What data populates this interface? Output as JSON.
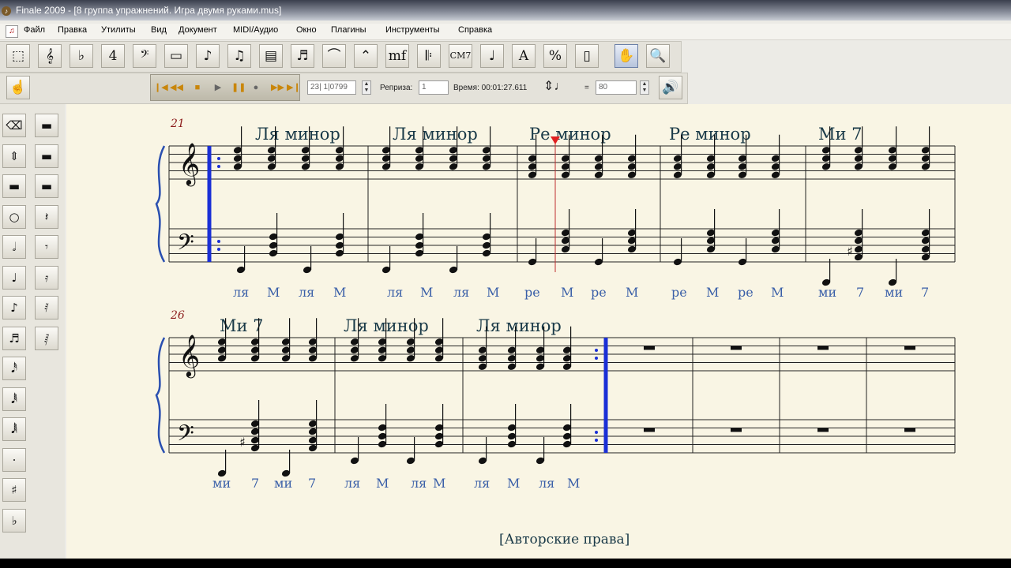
{
  "window": {
    "title": "Finale 2009 - [8 группа упражнений. Игра двумя руками.mus]"
  },
  "menu": [
    "Файл",
    "Правка",
    "Утилиты",
    "Вид",
    "Документ",
    "MIDI/Аудио",
    "Окно",
    "Плагины",
    "Инструменты",
    "Справка"
  ],
  "toolbar": {
    "tools": [
      {
        "icon": "selection-tool-icon",
        "glyph": "⬚"
      },
      {
        "icon": "staff-tool-icon",
        "glyph": "𝄞"
      },
      {
        "icon": "key-signature-tool-icon",
        "glyph": "♭"
      },
      {
        "icon": "time-signature-tool-icon",
        "glyph": "4"
      },
      {
        "icon": "clef-tool-icon",
        "glyph": "𝄢"
      },
      {
        "icon": "measure-tool-icon",
        "glyph": "▭"
      },
      {
        "icon": "simple-entry-tool-icon",
        "glyph": "♪"
      },
      {
        "icon": "speedy-entry-tool-icon",
        "glyph": "♫"
      },
      {
        "icon": "hyperscribe-tool-icon",
        "glyph": "▤"
      },
      {
        "icon": "tuplet-tool-icon",
        "glyph": "♬"
      },
      {
        "icon": "smart-shape-tool-icon",
        "glyph": "⌒"
      },
      {
        "icon": "articulation-tool-icon",
        "glyph": "⌃"
      },
      {
        "icon": "expression-tool-icon",
        "glyph": "mf"
      },
      {
        "icon": "repeat-tool-icon",
        "glyph": "𝄆"
      },
      {
        "icon": "chord-tool-icon",
        "glyph": "CM7"
      },
      {
        "icon": "lyrics-tool-icon",
        "glyph": "♩"
      },
      {
        "icon": "text-tool-icon",
        "glyph": "A"
      },
      {
        "icon": "resize-tool-icon",
        "glyph": "%"
      },
      {
        "icon": "page-layout-tool-icon",
        "glyph": "▯"
      },
      {
        "icon": "hand-grabber-tool-icon",
        "glyph": "✋"
      },
      {
        "icon": "zoom-tool-icon",
        "glyph": "🔍"
      }
    ]
  },
  "playback": {
    "counter": "23| 1|0799",
    "repeat_label": "Реприза:",
    "repeat_value": "1",
    "time_label": "Время: 00:01:27.611",
    "equals": "=",
    "tempo_value": "80"
  },
  "palette": {
    "col1": [
      "eraser-icon",
      "half-step-icon",
      "multirest-icon",
      "whole-note-icon",
      "half-note-icon",
      "quarter-note-icon",
      "eighth-note-icon",
      "sixteenth-note-icon",
      "thirty-second-note-icon",
      "sixty-fourth-note-icon",
      "one-twenty-eighth-note-icon",
      "dot-icon",
      "sharp-icon",
      "flat-icon"
    ],
    "col2": [
      "whole-rest-icon",
      "half-rest-icon",
      "half-rest-alt-icon",
      "quarter-rest-icon",
      "eighth-rest-icon",
      "sixteenth-rest-icon",
      "thirty-second-rest-icon",
      "sixty-fourth-rest-icon"
    ]
  },
  "score": {
    "system1": {
      "measure_number": "21",
      "chords": [
        "Ля минор",
        "Ля минор",
        "Ре минор",
        "Ре минор",
        "Ми 7"
      ],
      "lyrics": [
        "ля",
        "М",
        "ля",
        "М",
        "ля",
        "М",
        "ля",
        "М",
        "ре",
        "М",
        "ре",
        "М",
        "ре",
        "М",
        "ре",
        "М",
        "ми",
        "7",
        "ми",
        "7"
      ]
    },
    "system2": {
      "measure_number": "26",
      "chords": [
        "Ми 7",
        "Ля минор",
        "Ля минор"
      ],
      "lyrics": [
        "ми",
        "7",
        "ми",
        "7",
        "ля",
        "М",
        "ля",
        "М",
        "ля",
        "М",
        "ля",
        "М"
      ]
    },
    "copyright": "[Авторские права]"
  }
}
